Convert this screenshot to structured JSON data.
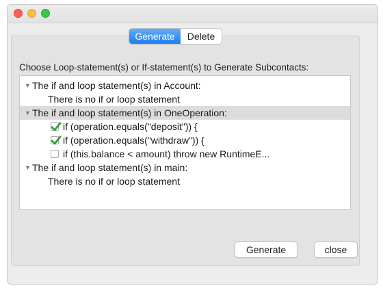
{
  "window": {
    "traffic_lights": {
      "close_color": "#fc605c",
      "minimize_color": "#fdbc40",
      "maximize_color": "#34c84a"
    }
  },
  "tabs": [
    {
      "label": "Generate",
      "active": true
    },
    {
      "label": "Delete",
      "active": false
    }
  ],
  "prompt": "Choose Loop-statement(s) or If-statement(s) to Generate Subcontacts:",
  "tree": {
    "groups": [
      {
        "label": "The if and loop statement(s) in Account:",
        "expanded": true,
        "selected": false,
        "message": "There is no if or loop statement"
      },
      {
        "label": "The if and loop statement(s) in OneOperation:",
        "expanded": true,
        "selected": true,
        "items": [
          {
            "label": "if (operation.equals(\"deposit\")) {",
            "checked": true
          },
          {
            "label": "if (operation.equals(\"withdraw\")) {",
            "checked": true
          },
          {
            "label": "if (this.balance < amount) throw new RuntimeE...",
            "checked": false
          }
        ]
      },
      {
        "label": "The if and loop statement(s) in main:",
        "expanded": true,
        "selected": false,
        "message": "There is no if or loop statement"
      }
    ]
  },
  "buttons": {
    "generate_label": "Generate",
    "close_label": "close"
  },
  "colors": {
    "accent": "#1c7ef0",
    "checkmark": "#3b9a3e"
  }
}
